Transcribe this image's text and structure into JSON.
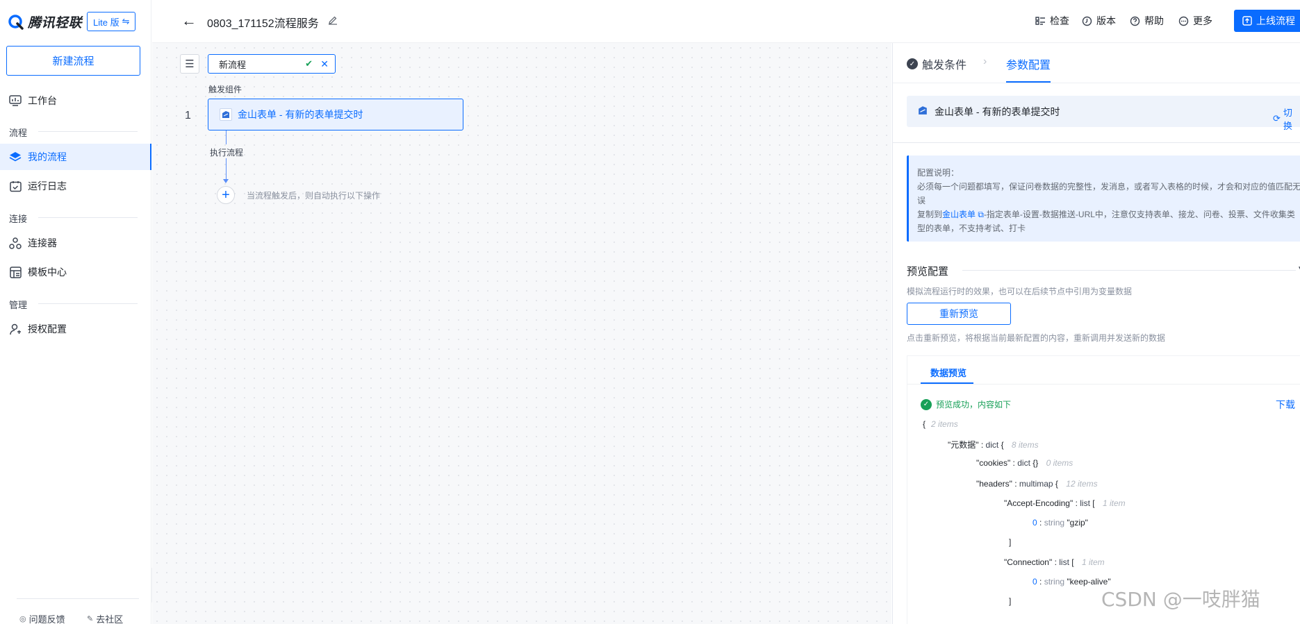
{
  "app": {
    "name": "腾讯轻联",
    "edition": "Lite 版"
  },
  "sidebar": {
    "new_flow": "新建流程",
    "workspace": "工作台",
    "section_flow": "流程",
    "my_flows": "我的流程",
    "run_log": "运行日志",
    "section_connect": "连接",
    "connectors": "连接器",
    "templates": "模板中心",
    "section_manage": "管理",
    "auth_config": "授权配置",
    "feedback": "问题反馈",
    "community": "去社区"
  },
  "header": {
    "title": "0803_171152流程服务",
    "check": "检查",
    "version": "版本",
    "help": "帮助",
    "more": "更多",
    "publish": "上线流程"
  },
  "canvas": {
    "flow_tab": "新流程",
    "trigger_label": "触发组件",
    "step_number": "1",
    "trigger_card": "金山表单 - 有新的表单提交时",
    "exec_label": "执行流程",
    "add_hint": "当流程触发后，则自动执行以下操作"
  },
  "panel": {
    "tab_trigger": "触发条件",
    "tab_params": "参数配置",
    "source_title": "金山表单 - 有新的表单提交时",
    "switch": "切换",
    "info_title": "配置说明：",
    "info_line1": "必须每一个问题都填写，保证问卷数据的完整性，发消息，或者写入表格的时候，才会和对应的值匹配无误",
    "info_line2_pre": "复制到",
    "info_link": "金山表单",
    "info_line2_post": "-指定表单-设置-数据推送-URL中，注意仅支持表单、接龙、问卷、投票、文件收集类型的表单，不支持考试、打卡",
    "preview_title": "预览配置",
    "preview_desc": "模拟流程运行时的效果，也可以在后续节点中引用为变量数据",
    "repreview": "重新预览",
    "repreview_note": "点击重新预览，将根据当前最新配置的内容，重新调用并发送新的数据",
    "data_preview_tab": "数据预览",
    "success": "预览成功，内容如下",
    "download": "下载"
  },
  "json_tree": {
    "root_meta": "2 items",
    "meta_key": "\"元数据\"",
    "meta_type": "dict",
    "meta_count": "8 items",
    "cookies_key": "\"cookies\"",
    "cookies_type": "dict",
    "cookies_count": "0 items",
    "headers_key": "\"headers\"",
    "headers_type": "multimap",
    "headers_count": "12 items",
    "ae_key": "\"Accept-Encoding\"",
    "ae_type": "list",
    "ae_count": "1 item",
    "ae_idx": "0",
    "ae_vtype": "string",
    "ae_val": "\"gzip\"",
    "conn_key": "\"Connection\"",
    "conn_type": "list",
    "conn_count": "1 item",
    "conn_idx": "0",
    "conn_vtype": "string",
    "conn_val": "\"keep-alive\""
  },
  "watermark": "CSDN @一吱胖猫",
  "colors": {
    "accent": "#0a6cff",
    "success": "#18a058"
  }
}
